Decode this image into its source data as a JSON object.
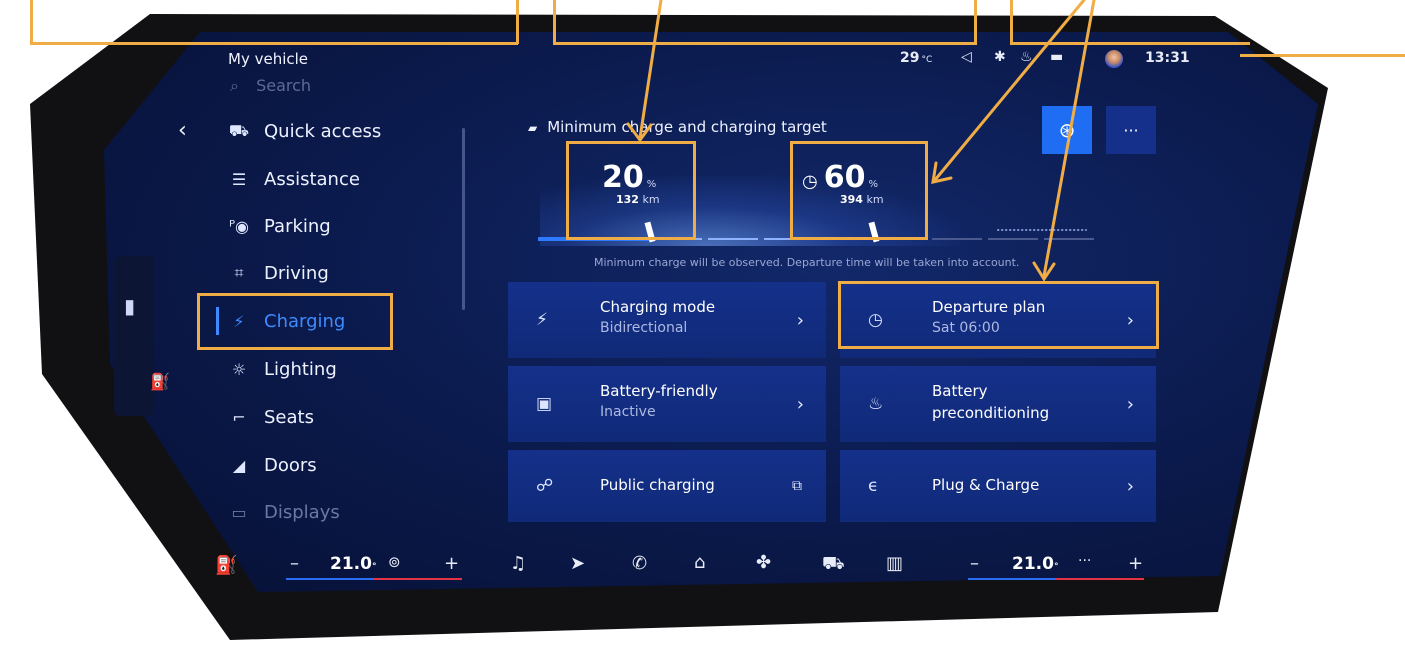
{
  "status_bar": {
    "section_title": "My vehicle",
    "temperature": "29",
    "temperature_unit": "°C",
    "time": "13:31"
  },
  "sidebar": {
    "search_placeholder": "Search",
    "items": [
      {
        "label": "Quick access",
        "icon": "car-front-icon"
      },
      {
        "label": "Assistance",
        "icon": "assistance-icon"
      },
      {
        "label": "Parking",
        "icon": "parking-icon"
      },
      {
        "label": "Driving",
        "icon": "driving-icon"
      },
      {
        "label": "Charging",
        "icon": "charging-icon",
        "active": true
      },
      {
        "label": "Lighting",
        "icon": "light-icon"
      },
      {
        "label": "Seats",
        "icon": "seat-icon"
      },
      {
        "label": "Doors",
        "icon": "door-icon"
      },
      {
        "label": "Displays",
        "icon": "display-icon"
      }
    ]
  },
  "charge": {
    "header": "Minimum charge and charging target",
    "minimum": {
      "value": "20",
      "unit": "%",
      "range": "132",
      "range_unit": "km"
    },
    "target": {
      "value": "60",
      "unit": "%",
      "range": "394",
      "range_unit": "km"
    },
    "slider_min_fraction": 0.2,
    "slider_target_fraction": 0.6,
    "note": "Minimum charge will be observed. Departure time will be taken into account."
  },
  "tiles": [
    {
      "title": "Charging mode",
      "subtitle": "Bidirectional",
      "icon": "pro-charging-icon",
      "action": "chevron-right"
    },
    {
      "title": "Departure plan",
      "subtitle": "Sat 06:00",
      "icon": "clock-icon",
      "action": "chevron-right"
    },
    {
      "title": "Battery-friendly",
      "subtitle": "Inactive",
      "icon": "battery-icon",
      "action": "chevron-right"
    },
    {
      "title": "Battery",
      "subtitle": "preconditioning",
      "icon": "battery-heat-icon",
      "action": "chevron-right"
    },
    {
      "title": "Public charging",
      "subtitle": "",
      "icon": "public-charging-icon",
      "action": "external-link"
    },
    {
      "title": "Plug & Charge",
      "subtitle": "",
      "icon": "plug-icon",
      "action": "chevron-right"
    }
  ],
  "bottom_bar": {
    "left_temp": "21.0",
    "right_temp": "21.0",
    "minus": "–",
    "plus": "+"
  },
  "colors": {
    "accent": "#3e8bff",
    "annotation": "#f0ad45",
    "tile_bg": "#12307f",
    "screen_bg": "#0b1a4c"
  }
}
